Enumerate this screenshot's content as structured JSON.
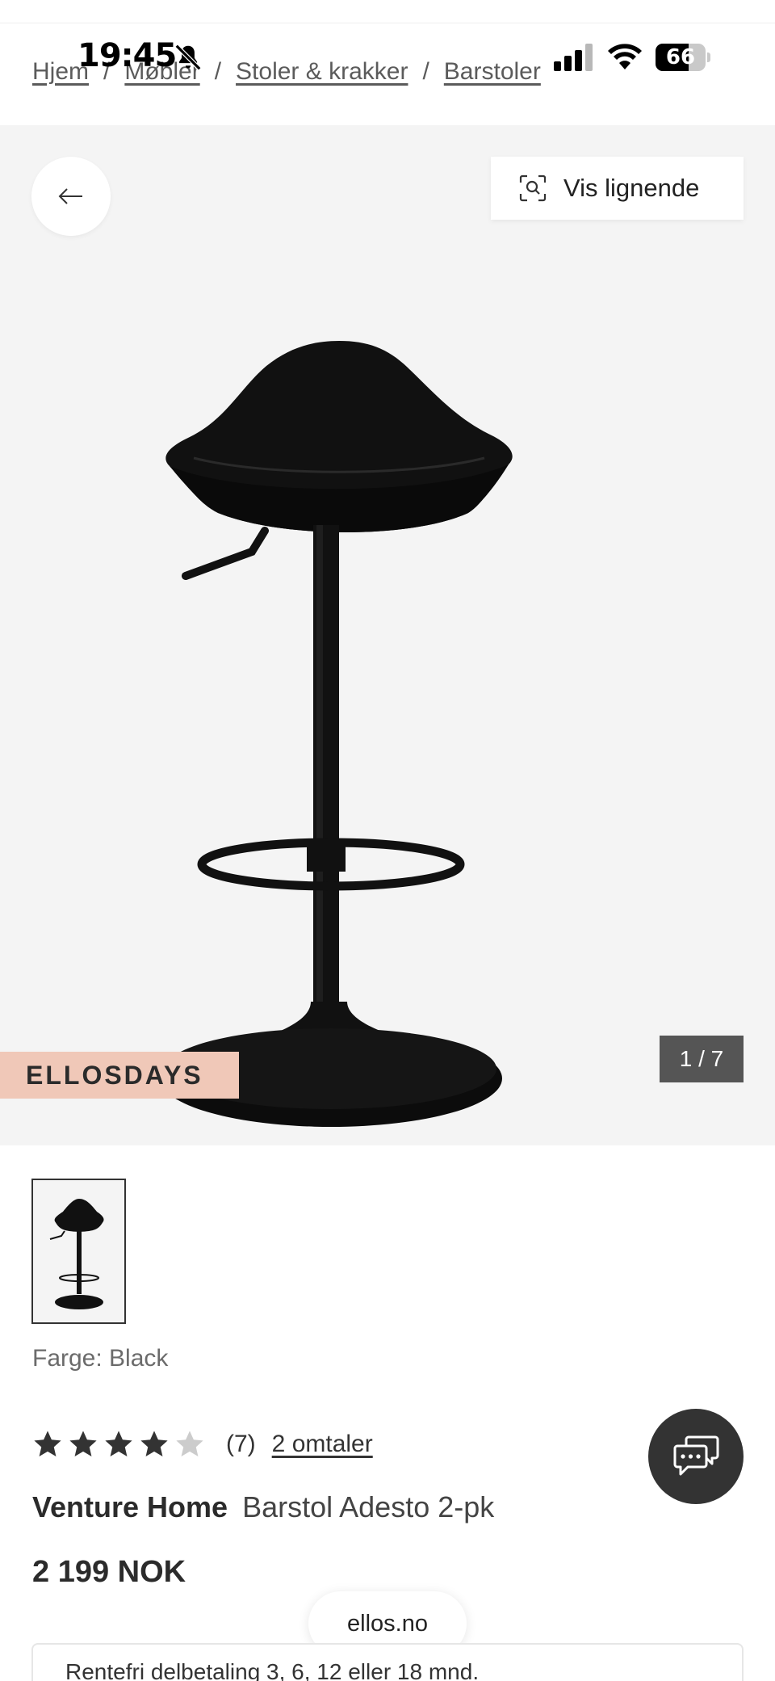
{
  "status_bar": {
    "time": "19:45",
    "battery": "66",
    "battery_level": 0.66
  },
  "breadcrumb": [
    "Hjem",
    "Møbler",
    "Stoler & krakker",
    "Barstoler"
  ],
  "hero": {
    "similar_label": "Vis lignende",
    "promo_badge": "ELLOSDAYS",
    "counter": "1 / 7"
  },
  "product": {
    "color_label": "Farge: Black",
    "rating_value": 4,
    "rating_max": 5,
    "review_count": "(7)",
    "reviews_link": "2 omtaler",
    "brand": "Venture Home",
    "name": "Barstol Adesto 2-pk",
    "price": "2 199 NOK"
  },
  "url_pill": "ellos.no",
  "finance": {
    "text": "Rentefri delbetaling 3, 6, 12 eller 18 mnd."
  },
  "colors": {
    "hero_bg": "#f4f4f4",
    "promo_bg": "#f0c8b8",
    "counter_bg": "#555555",
    "chat_bg": "#333333",
    "star_filled": "#333333",
    "star_empty": "#cccccc"
  },
  "icons": [
    "bell-off-icon",
    "cellular-signal-icon",
    "wifi-icon",
    "battery-icon",
    "arrow-left-icon",
    "visual-search-icon",
    "star-icon",
    "chat-icon"
  ]
}
